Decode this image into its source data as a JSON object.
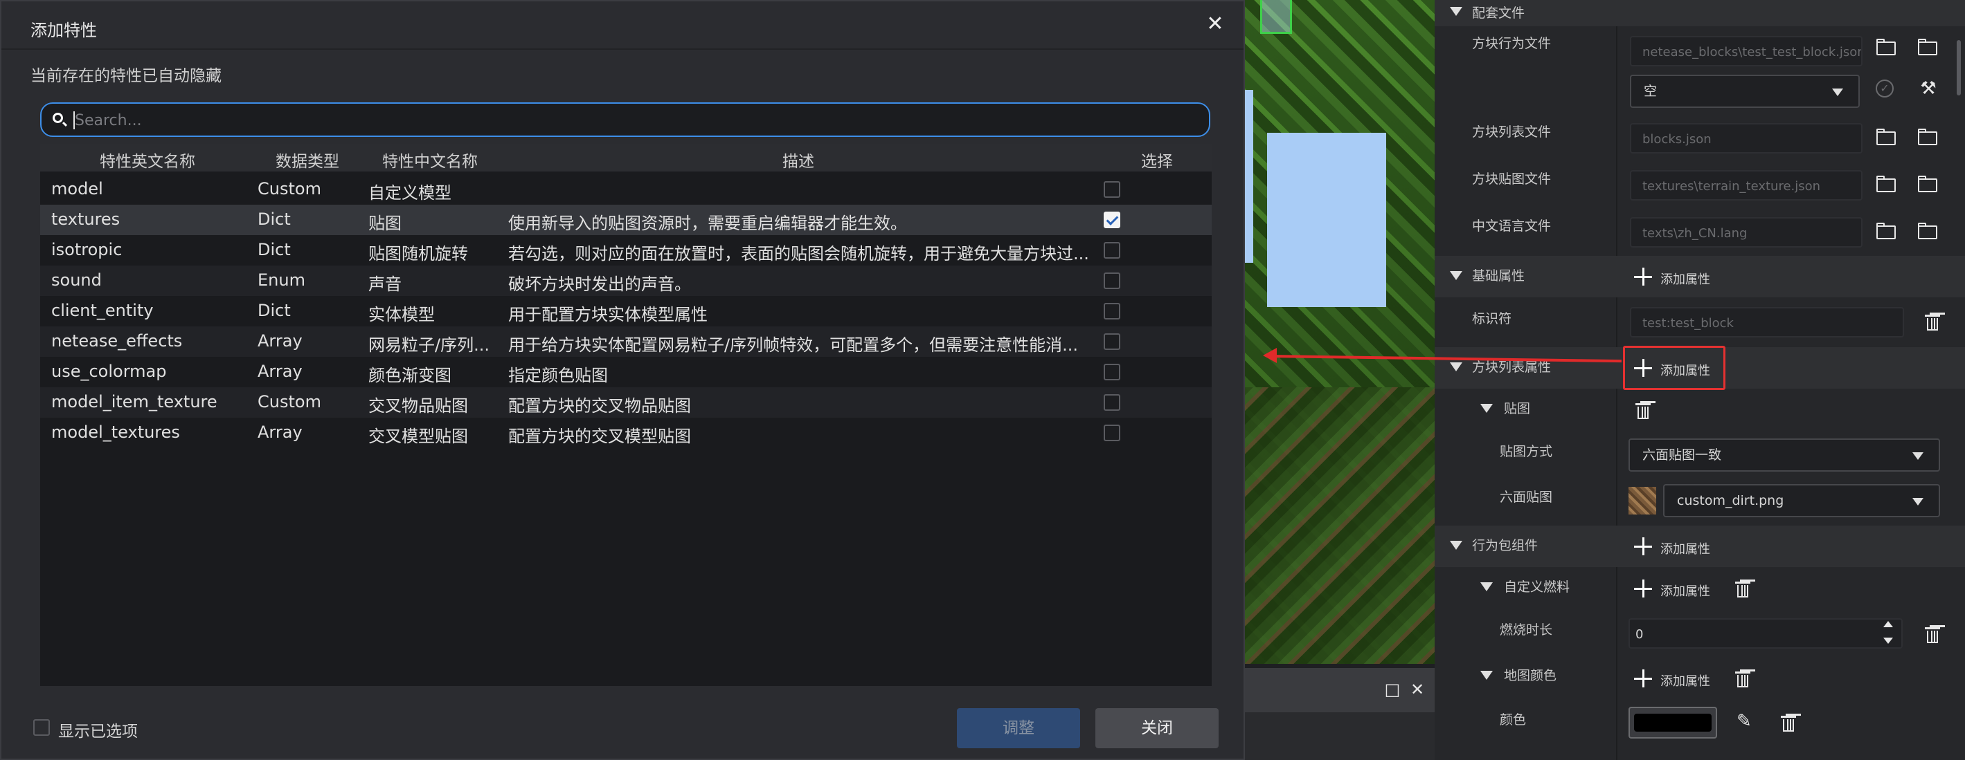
{
  "dialog": {
    "title": "添加特性",
    "hint": "当前存在的特性已自动隐藏",
    "search_placeholder": "Search...",
    "columns": [
      "特性英文名称",
      "数据类型",
      "特性中文名称",
      "描述",
      "选择"
    ],
    "rows": [
      {
        "en": "model",
        "type": "Custom",
        "cn": "自定义模型",
        "desc": "",
        "checked": false
      },
      {
        "en": "textures",
        "type": "Dict",
        "cn": "贴图",
        "desc": "使用新导入的贴图资源时，需要重启编辑器才能生效。",
        "checked": true
      },
      {
        "en": "isotropic",
        "type": "Dict",
        "cn": "贴图随机旋转",
        "desc": "若勾选，则对应的面在放置时，表面的贴图会随机旋转，用于避免大量方块过...",
        "checked": false
      },
      {
        "en": "sound",
        "type": "Enum",
        "cn": "声音",
        "desc": "破坏方块时发出的声音。",
        "checked": false
      },
      {
        "en": "client_entity",
        "type": "Dict",
        "cn": "实体模型",
        "desc": "用于配置方块实体模型属性",
        "checked": false
      },
      {
        "en": "netease_effects",
        "type": "Array",
        "cn": "网易粒子/序列...",
        "desc": "用于给方块实体配置网易粒子/序列帧特效，可配置多个，但需要注意性能消...",
        "checked": false
      },
      {
        "en": "use_colormap",
        "type": "Array",
        "cn": "颜色渐变图",
        "desc": "指定颜色贴图",
        "checked": false
      },
      {
        "en": "model_item_texture",
        "type": "Custom",
        "cn": "交叉物品贴图",
        "desc": "配置方块的交叉物品贴图",
        "checked": false
      },
      {
        "en": "model_textures",
        "type": "Array",
        "cn": "交叉模型贴图",
        "desc": "配置方块的交叉模型贴图",
        "checked": false
      }
    ],
    "show_selected_label": "显示已选项",
    "adjust_label": "调整",
    "close_label": "关闭"
  },
  "panel": {
    "config_files": {
      "header": "配套文件",
      "behavior_label": "方块行为文件",
      "behavior_value": "netease_blocks\\test_test_block.json",
      "empty_select": "空",
      "blocks_label": "方块列表文件",
      "blocks_value": "blocks.json",
      "texture_label": "方块贴图文件",
      "texture_value": "textures\\terrain_texture.json",
      "lang_label": "中文语言文件",
      "lang_value": "texts\\zh_CN.lang"
    },
    "basic": {
      "header": "基础属性",
      "add_label": "添加属性",
      "id_label": "标识符",
      "id_value": "test:test_block"
    },
    "block_list": {
      "header": "方块列表属性",
      "add_label": "添加属性",
      "texture_label": "贴图",
      "mode_label": "贴图方式",
      "mode_value": "六面贴图一致",
      "six_label": "六面贴图",
      "six_value": "custom_dirt.png"
    },
    "behavior": {
      "header": "行为包组件",
      "add_label": "添加属性",
      "fuel_label": "自定义燃料",
      "fuel_add": "添加属性",
      "burn_label": "燃烧时长",
      "burn_value": "0",
      "mapcolor_label": "地图颜色",
      "mapcolor_add": "添加属性",
      "color_label": "颜色",
      "color_value": "#000000"
    }
  },
  "icons": {
    "search": "search-icon",
    "close": "close-icon",
    "folder": "folder-icon",
    "trash": "trash-icon"
  }
}
